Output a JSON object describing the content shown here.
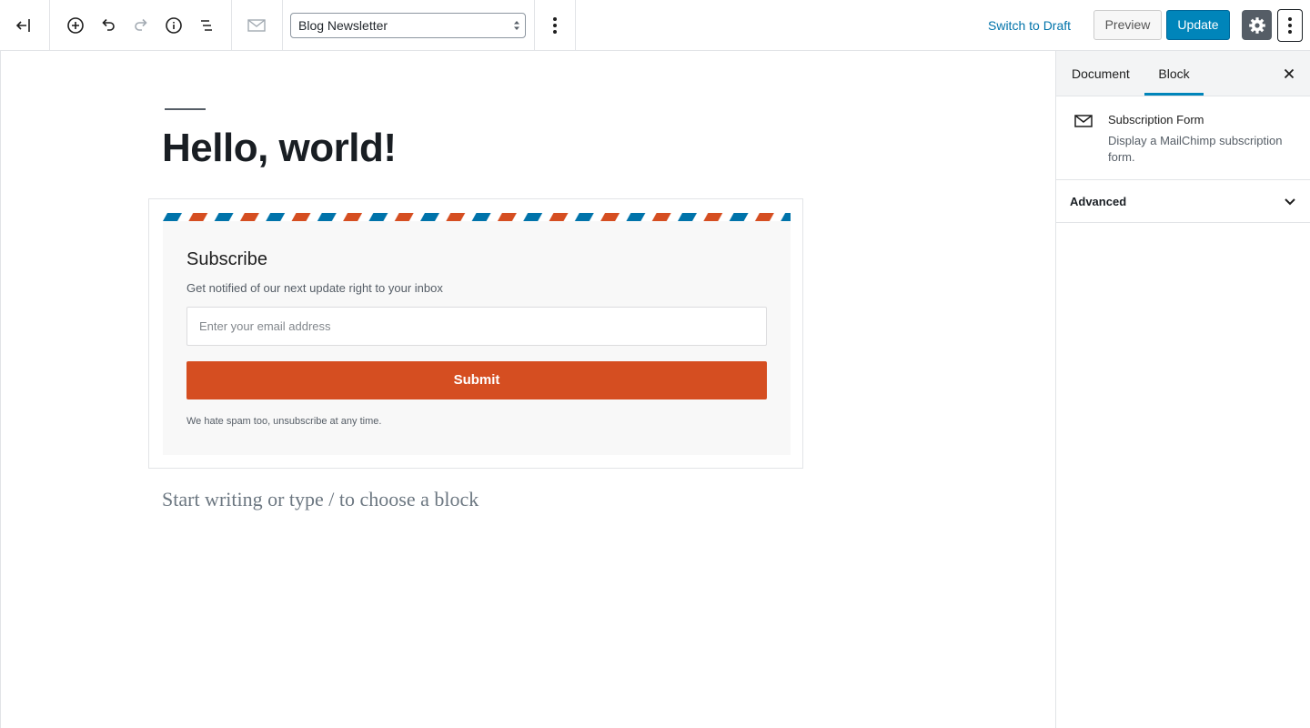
{
  "toolbar": {
    "icons": [
      "back-to-dashboard-icon",
      "add-block-icon",
      "undo-icon",
      "redo-icon",
      "info-icon",
      "outline-icon",
      "envelope-icon"
    ],
    "template_select": {
      "value": "Blog Newsletter"
    },
    "switch_to_draft": "Switch to Draft",
    "preview": "Preview",
    "update": "Update"
  },
  "editor": {
    "post_title": "Hello, world!",
    "subscribe_block": {
      "title": "Subscribe",
      "subtitle": "Get notified of our next update right to your inbox",
      "email_placeholder": "Enter your email address",
      "submit_label": "Submit",
      "note": "We hate spam too, unsubscribe at any time.",
      "stripe_colors": [
        "#0073aa",
        "#d54e21"
      ]
    },
    "block_placeholder": "Start writing or type / to choose a block"
  },
  "sidebar": {
    "tabs": [
      {
        "label": "Document",
        "active": false
      },
      {
        "label": "Block",
        "active": true
      }
    ],
    "block": {
      "name": "Subscription Form",
      "description": "Display a MailChimp subscription form."
    },
    "panels": [
      {
        "title": "Advanced",
        "expanded": false
      }
    ]
  },
  "colors": {
    "accent": "#0085ba",
    "link": "#0073aa",
    "submit": "#d54e21",
    "gear_bg": "#555d66"
  }
}
